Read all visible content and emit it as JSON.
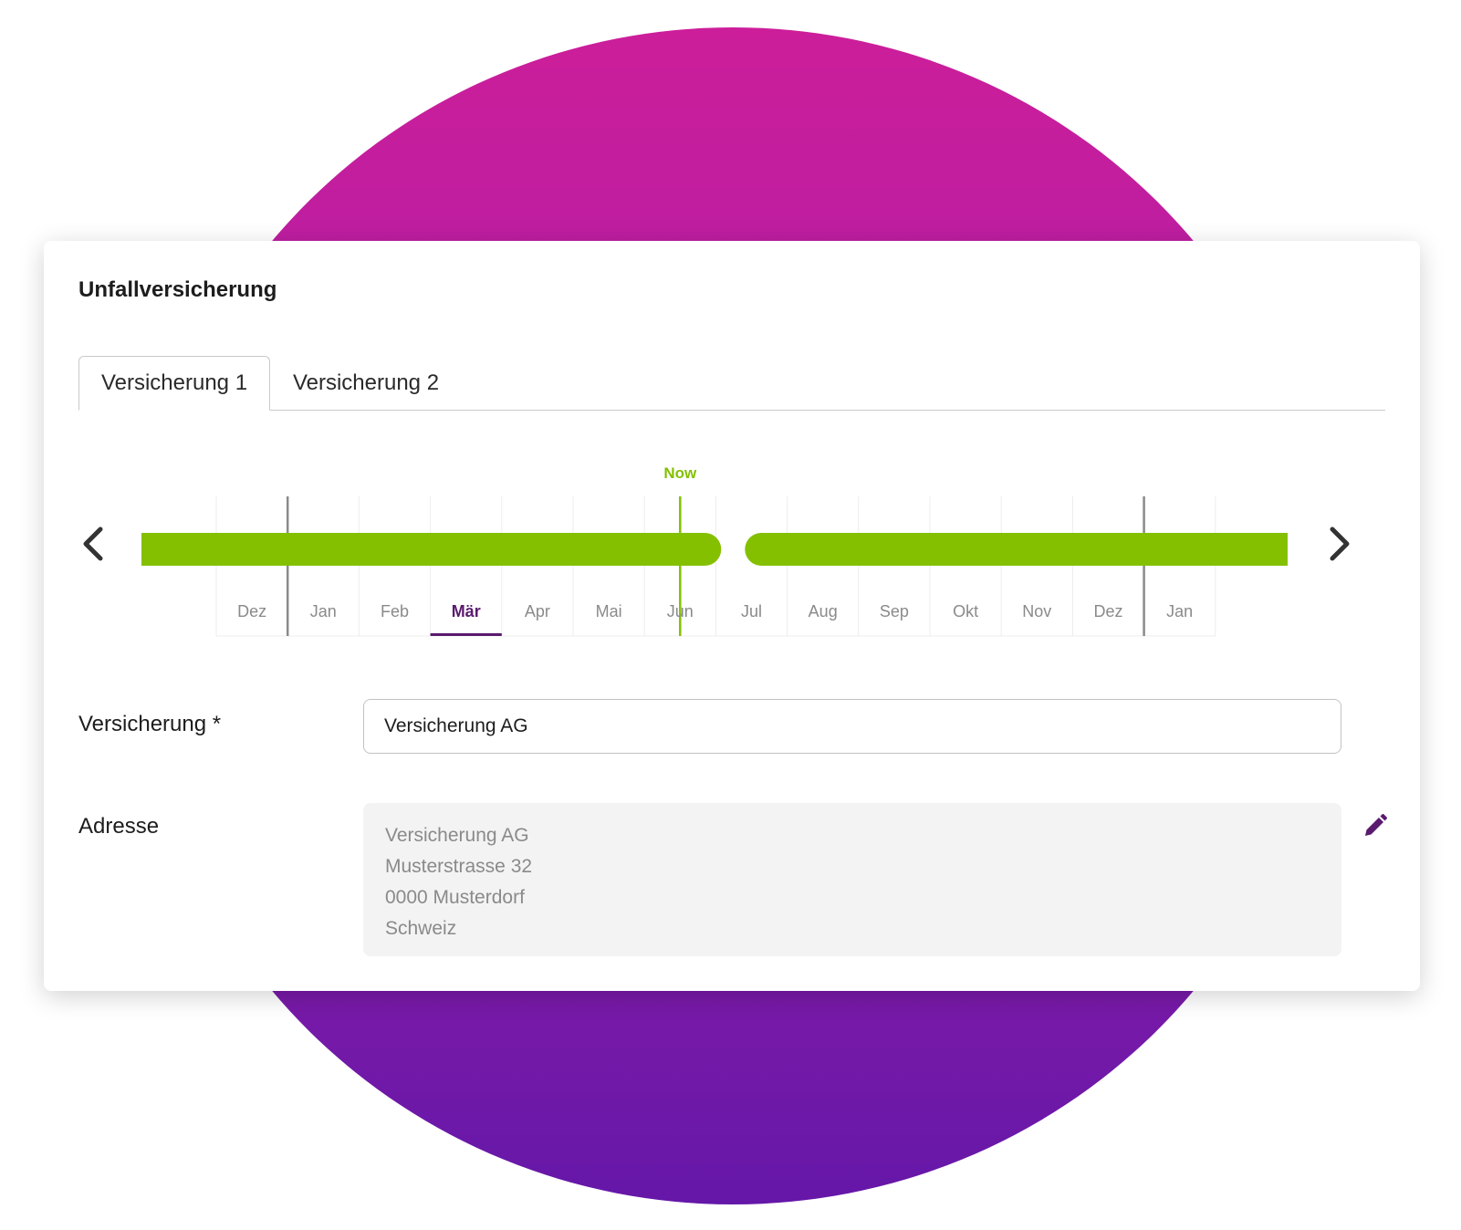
{
  "card": {
    "title": "Unfallversicherung"
  },
  "tabs": [
    {
      "label": "Versicherung 1",
      "active": true
    },
    {
      "label": "Versicherung 2",
      "active": false
    }
  ],
  "timeline": {
    "now_label": "Now",
    "months": [
      "Dez",
      "Jan",
      "Feb",
      "Mär",
      "Apr",
      "Mai",
      "Jun",
      "Jul",
      "Aug",
      "Sep",
      "Okt",
      "Nov",
      "Dez",
      "Jan"
    ],
    "selected_month_index": 3,
    "now_index": 6,
    "year_boundary_indices": [
      1,
      13
    ],
    "bar_color": "#84c000",
    "now_color": "#84c000",
    "selected_color": "#5a1a6e",
    "prev_icon": "chevron-left-icon",
    "next_icon": "chevron-right-icon"
  },
  "form": {
    "insurer_label": "Versicherung *",
    "insurer_value": "Versicherung AG",
    "address_label": "Adresse",
    "address_lines": [
      "Versicherung AG",
      "Musterstrasse 32",
      "0000 Musterdorf",
      "Schweiz"
    ],
    "edit_icon": "pencil-icon",
    "edit_icon_color": "#5a1a6e"
  }
}
